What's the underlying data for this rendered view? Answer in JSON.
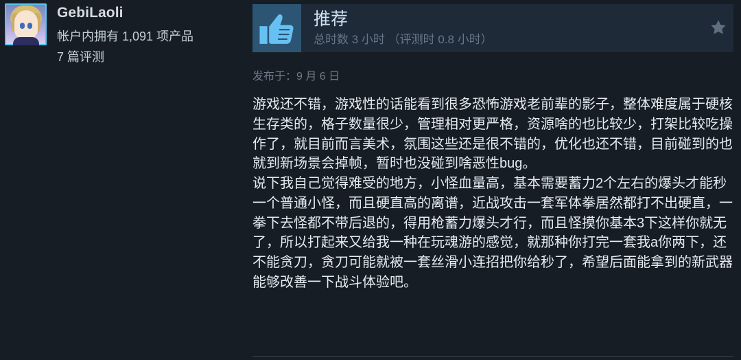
{
  "user": {
    "name": "GebiLaoli",
    "owned_products": "帐户内拥有 1,091 项产品",
    "review_count": "7 篇评测"
  },
  "review": {
    "recommendation": "推荐",
    "playtime": "总时数 3 小时 （评测时 0.8 小时）",
    "posted": "发布于：9 月 6 日",
    "body": "游戏还不错，游戏性的话能看到很多恐怖游戏老前辈的影子，整体难度属于硬核生存类的，格子数量很少，管理相对更严格，资源啥的也比较少，打架比较吃操作了，就目前而言美术，氛围这些还是很不错的，优化也还不错，目前碰到的也就到新场景会掉帧，暂时也没碰到啥恶性bug。\n说下我自己觉得难受的地方，小怪血量高，基本需要蓄力2个左右的爆头才能秒一个普通小怪，而且硬直高的离谱，近战攻击一套军体拳居然都打不出硬直，一拳下去怪都不带后退的，得用枪蓄力爆头才行，而且怪摸你基本3下这样你就无了，所以打起来又给我一种在玩魂游的感觉，就那种你打完一套我a你两下，还不能贪刀，贪刀可能就被一套丝滑小连招把你给秒了，希望后面能拿到的新武器能够改善一下战斗体验吧。"
  },
  "icons": {
    "thumb": "thumbs-up-icon",
    "award": "star-icon",
    "avatar": "avatar"
  },
  "colors": {
    "background": "#171d25",
    "thumb_box": "#2c5573",
    "thumb": "#66c0f4",
    "title": "#cfe2f4",
    "muted": "#667786",
    "text": "#e4ebf1"
  }
}
